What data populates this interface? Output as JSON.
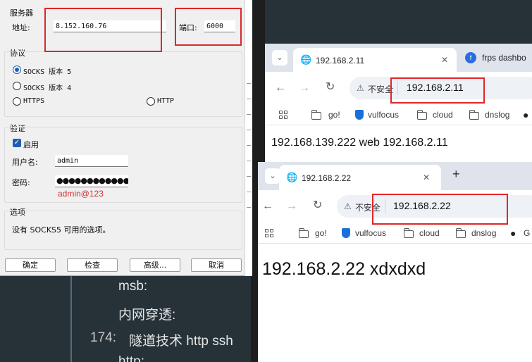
{
  "editor": {
    "line1": "msb:",
    "line2": "内网穿透:",
    "line3_num": "174:",
    "line3": "隧道技术 http ssh",
    "line4": "http:"
  },
  "proxy_dialog": {
    "server_group": "服务器",
    "address_label": "地址:",
    "address_value": "8.152.160.76",
    "port_label": "端口:",
    "port_value": "6000",
    "protocol_group": "协议",
    "protocols": [
      "SOCKS 版本 5",
      "SOCKS 版本 4",
      "HTTPS",
      "HTTP"
    ],
    "selected_protocol": "SOCKS 版本 5",
    "auth_group": "验证",
    "enable_label": "启用",
    "username_label": "用户名:",
    "username_value": "admin",
    "password_label": "密码:",
    "password_mask": "●●●●●●●●●●●●",
    "password_note": "admin@123",
    "options_group": "选项",
    "options_text": "没有 SOCKS5 可用的选项。",
    "buttons": {
      "ok": "确定",
      "check": "检查",
      "advanced": "高级...",
      "cancel": "取消"
    }
  },
  "browser1": {
    "tab_active": "192.168.2.11",
    "tab_other": "frps dashbo",
    "insecure_label": "不安全",
    "url": "192.168.2.11",
    "bookmarks": [
      "go!",
      "vulfocus",
      "cloud",
      "dnslog"
    ],
    "page_text": "192.168.139.222 web 192.168.2.11"
  },
  "browser2": {
    "tab_active": "192.168.2.22",
    "new_tab": "+",
    "insecure_label": "不安全",
    "url": "192.168.2.22",
    "bookmarks": [
      "go!",
      "vulfocus",
      "cloud",
      "dnslog",
      "G"
    ],
    "page_text": "192.168.2.22 xdxdxd"
  },
  "colors": {
    "highlight": "#e0262a",
    "accent": "#1a5fb4",
    "note": "#d0302f"
  }
}
